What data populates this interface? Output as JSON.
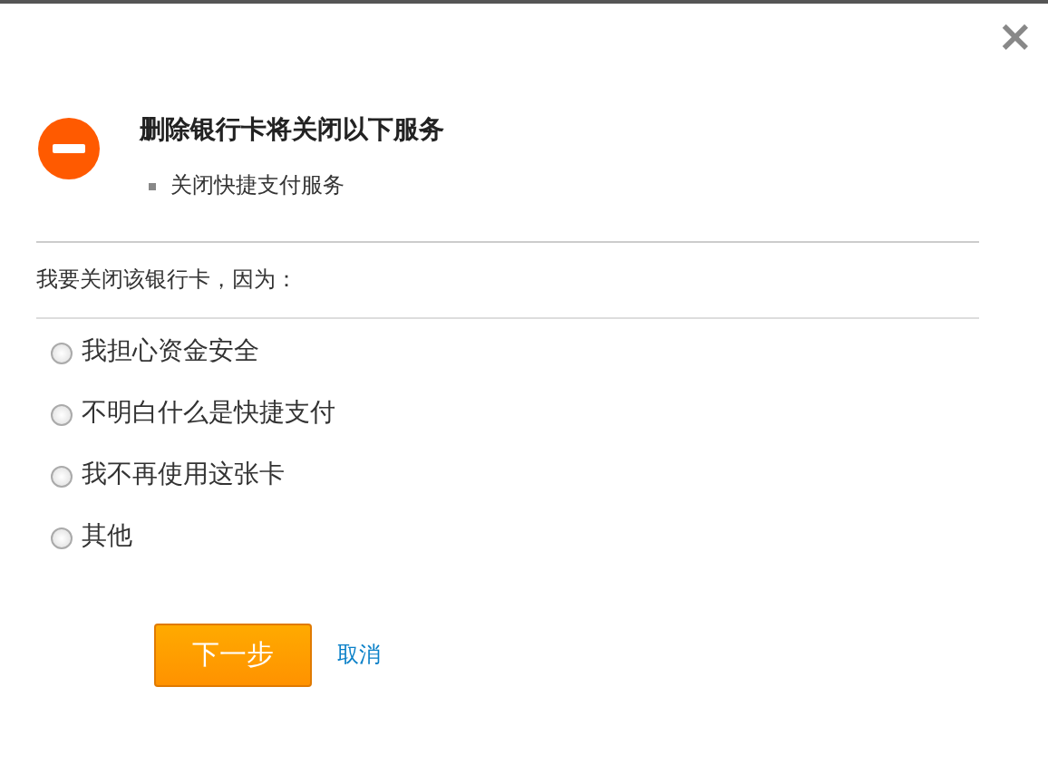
{
  "dialog": {
    "close": "×",
    "title": "删除银行卡将关闭以下服务",
    "services": [
      "关闭快捷支付服务"
    ],
    "reason_label": "我要关闭该银行卡，因为：",
    "reasons": [
      {
        "label": "我担心资金安全",
        "selected": false
      },
      {
        "label": "不明白什么是快捷支付",
        "selected": false
      },
      {
        "label": "我不再使用这张卡",
        "selected": false
      },
      {
        "label": "其他",
        "selected": false
      }
    ],
    "next_button": "下一步",
    "cancel_link": "取消"
  }
}
